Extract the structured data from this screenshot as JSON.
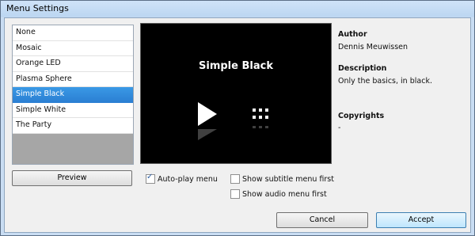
{
  "window": {
    "title": "Menu Settings"
  },
  "themes": {
    "items": [
      "None",
      "Mosaic",
      "Orange LED",
      "Plasma Sphere",
      "Simple Black",
      "Simple White",
      "The Party"
    ],
    "selected_index": 4
  },
  "preview": {
    "title": "Simple Black",
    "button_label": "Preview"
  },
  "info": {
    "author_label": "Author",
    "author_value": "Dennis Meuwissen",
    "description_label": "Description",
    "description_value": "Only the basics, in black.",
    "copyrights_label": "Copyrights",
    "copyrights_value": "-"
  },
  "options": {
    "autoplay_label": "Auto-play menu",
    "autoplay_checked": true,
    "subtitle_first_label": "Show subtitle menu first",
    "subtitle_first_checked": false,
    "audio_first_label": "Show audio menu first",
    "audio_first_checked": false
  },
  "buttons": {
    "cancel": "Cancel",
    "accept": "Accept"
  }
}
